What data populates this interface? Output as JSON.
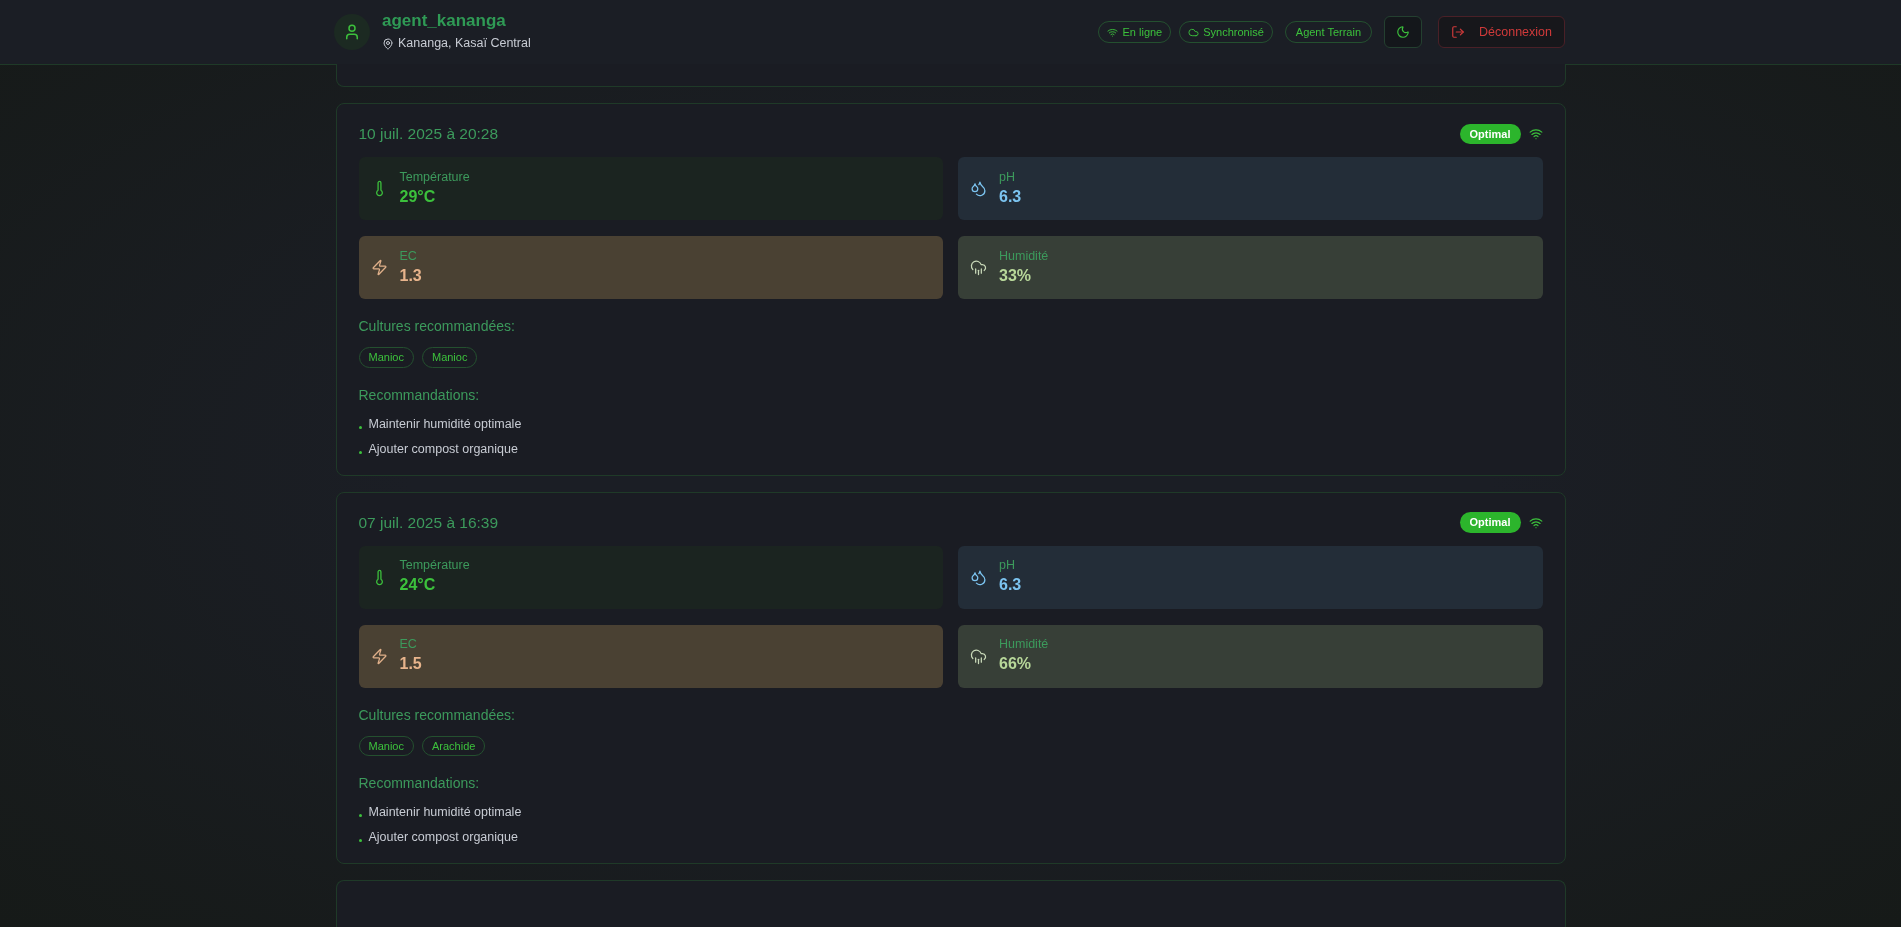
{
  "header": {
    "username": "agent_kananga",
    "location": "Kananga, Kasaï Central",
    "badges": [
      {
        "kind": "online",
        "label": "En ligne"
      },
      {
        "kind": "sync",
        "label": "Synchronisé"
      },
      {
        "kind": "role",
        "label": "Agent Terrain"
      }
    ],
    "logout": "Déconnexion"
  },
  "readings": [
    {
      "date": "10 juil. 2025 à 20:28",
      "status": "Optimal",
      "metrics": [
        {
          "kind": "temperature",
          "label": "Température",
          "value": "29°C"
        },
        {
          "kind": "ph",
          "label": "pH",
          "value": "6.3"
        },
        {
          "kind": "ec",
          "label": "EC",
          "value": "1.3"
        },
        {
          "kind": "humidity",
          "label": "Humidité",
          "value": "33%"
        }
      ],
      "crops_title": "Cultures recommandées:",
      "crops": [
        "Manioc",
        "Manioc"
      ],
      "recs_title": "Recommandations:",
      "recommendations": [
        "Maintenir humidité optimale",
        "Ajouter compost organique"
      ]
    },
    {
      "date": "07 juil. 2025 à 16:39",
      "status": "Optimal",
      "metrics": [
        {
          "kind": "temperature",
          "label": "Température",
          "value": "24°C"
        },
        {
          "kind": "ph",
          "label": "pH",
          "value": "6.3"
        },
        {
          "kind": "ec",
          "label": "EC",
          "value": "1.5"
        },
        {
          "kind": "humidity",
          "label": "Humidité",
          "value": "66%"
        }
      ],
      "crops_title": "Cultures recommandées:",
      "crops": [
        "Manioc",
        "Arachide"
      ],
      "recs_title": "Recommandations:",
      "recommendations": [
        "Maintenir humidité optimale",
        "Ajouter compost organique"
      ]
    }
  ]
}
